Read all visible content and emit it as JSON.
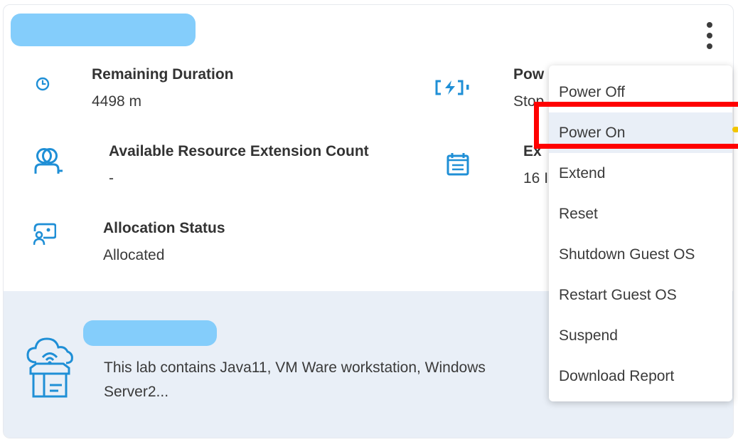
{
  "colors": {
    "accent": "#1f8fd6",
    "highlight": "#ff0000",
    "lab_background": "#e9eff7",
    "redaction": "#84cdfb"
  },
  "details": {
    "remaining_duration": {
      "icon": "clock-icon",
      "label": "Remaining Duration",
      "value": "4498 m"
    },
    "power": {
      "icon": "power-status-icon",
      "label_partial": "Pow",
      "value_partial": "Stop"
    },
    "extension_count": {
      "icon": "users-icon",
      "label": "Available Resource Extension Count",
      "value": "-"
    },
    "expiry": {
      "icon": "calendar-icon",
      "label_partial": "Ex",
      "value_partial": "16 I"
    },
    "allocation_status": {
      "icon": "allocation-icon",
      "label": "Allocation Status",
      "value": "Allocated"
    }
  },
  "lab": {
    "icon": "cloud-box-icon",
    "description": "This lab contains Java11, VM Ware workstation, Windows Server2..."
  },
  "menu": {
    "items": [
      {
        "label": "Power Off"
      },
      {
        "label": "Power On"
      },
      {
        "label": "Extend"
      },
      {
        "label": "Reset"
      },
      {
        "label": "Shutdown Guest OS"
      },
      {
        "label": "Restart Guest OS"
      },
      {
        "label": "Suspend"
      },
      {
        "label": "Download Report"
      }
    ]
  }
}
